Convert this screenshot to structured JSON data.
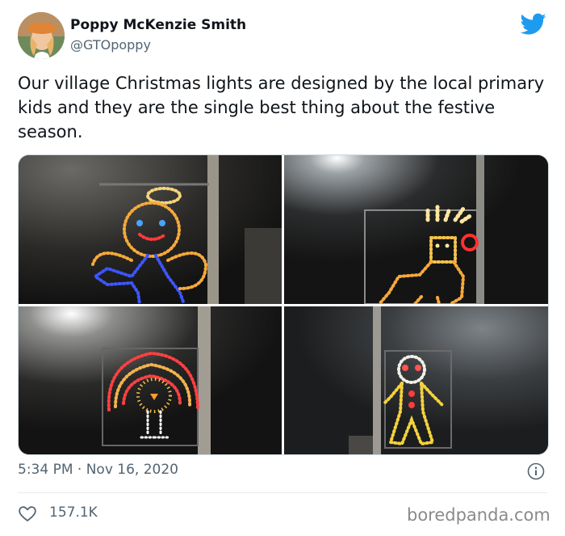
{
  "author": {
    "name": "Poppy McKenzie Smith",
    "handle": "@GTOpoppy"
  },
  "tweet": {
    "text": "Our village Christmas lights are designed by the local primary kids and they are the single best thing about the festive season."
  },
  "meta": {
    "time": "5:34 PM",
    "separator": "·",
    "date": "Nov 16, 2020",
    "timestamp": "5:34 PM · Nov 16, 2020"
  },
  "engagement": {
    "likes": "157.1K"
  },
  "watermark": "boredpanda.com",
  "icons": {
    "brand": "twitter-bird-icon",
    "info": "info-icon",
    "like": "heart-icon"
  },
  "colors": {
    "twitter_blue": "#1d9bf0",
    "secondary_text": "#536471",
    "primary_text": "#0f1419"
  }
}
